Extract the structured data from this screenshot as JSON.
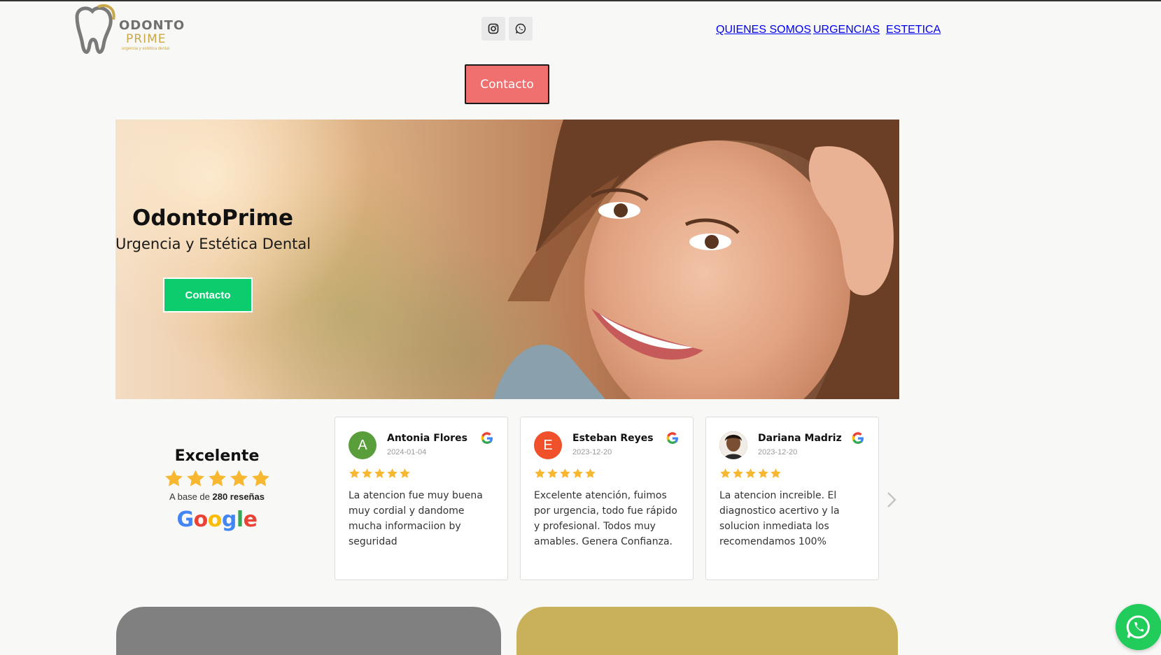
{
  "brand": {
    "word1": "ODONTO",
    "word2": "PRIME",
    "tagline": "urgencia y estética dental",
    "gold": "#c9a84a",
    "gray": "#6f6f6f"
  },
  "header": {
    "social": [
      {
        "icon": "instagram-icon"
      },
      {
        "icon": "whatsapp-icon"
      }
    ],
    "nav": [
      "QUIENES SOMOS",
      "URGENCIAS",
      "ESTETICA"
    ],
    "contact_button": "Contacto"
  },
  "hero": {
    "title": "OdontoPrime",
    "subtitle": "Urgencia y Estética Dental",
    "button": "Contacto",
    "button_color": "#0dcc6e"
  },
  "reviews_summary": {
    "title": "Excelente",
    "stars": 5,
    "base_prefix": "A base de",
    "base_count": "280 reseñas",
    "logo_word": "Google"
  },
  "reviews": [
    {
      "name": "Antonia Flores",
      "date": "2024-01-04",
      "initial": "A",
      "avatar_color": "#5a9e3c",
      "stars": 5,
      "text": "La atencion fue muy buena muy cordial y dandome mucha informaciion by seguridad"
    },
    {
      "name": "Esteban Reyes",
      "date": "2023-12-20",
      "initial": "E",
      "avatar_color": "#f0502a",
      "stars": 5,
      "text": "Excelente atención, fuimos por urgencia, todo fue rápido y profesional. Todos muy amables. Genera Confianza."
    },
    {
      "name": "Dariana Madriz",
      "date": "2023-12-20",
      "initial": "",
      "avatar_color": "#4a3426",
      "stars": 5,
      "text": "La atencion increible. El diagnostico acertivo y la solucion inmediata los recomendamos 100%"
    }
  ],
  "colors": {
    "contact_top": "#f07070",
    "star": "#f7b731",
    "bottom_left": "#808080",
    "bottom_right": "#c9b05a",
    "whatsapp": "#22cc5b"
  }
}
